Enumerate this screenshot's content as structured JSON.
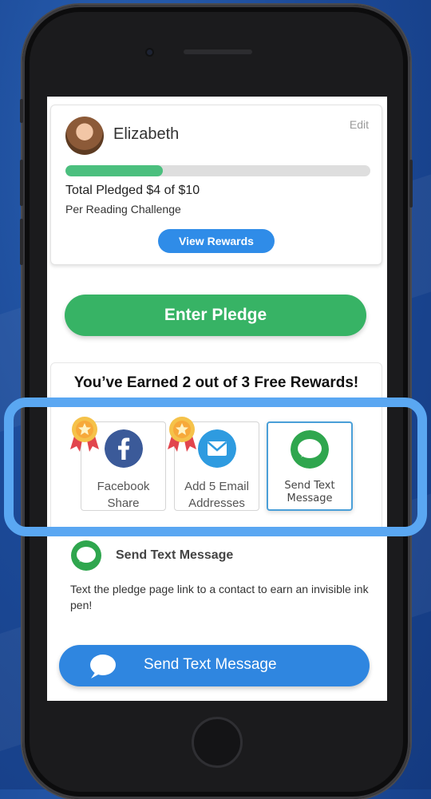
{
  "profile": {
    "name": "Elizabeth",
    "edit_label": "Edit",
    "progress_fraction": 0.32,
    "pledged_text": "Total Pledged $4 of $10",
    "per_text": "Per Reading Challenge",
    "view_rewards_label": "View Rewards"
  },
  "enter_pledge_label": "Enter Pledge",
  "rewards": {
    "title": "You’ve Earned 2 out of 3 Free Rewards!",
    "tiles": [
      {
        "line1": "Facebook",
        "line2": "Share",
        "icon": "facebook-icon",
        "earned": true
      },
      {
        "line1": "Add 5 Email",
        "line2": "Addresses",
        "icon": "email-icon",
        "earned": true
      },
      {
        "line1": "Send Text",
        "line2": "Message",
        "icon": "chat-bubble-icon",
        "earned": false,
        "selected": true
      }
    ]
  },
  "detail": {
    "title": "Send Text Message",
    "description": "Text the pledge page link to a contact to earn an invisible ink pen!"
  },
  "send_button_label": "Send Text Message",
  "colors": {
    "green": "#37b365",
    "blue": "#2f86e0",
    "facebook_blue": "#3b5a99",
    "email_blue": "#2e9be0",
    "highlight": "#5aa7f2"
  }
}
